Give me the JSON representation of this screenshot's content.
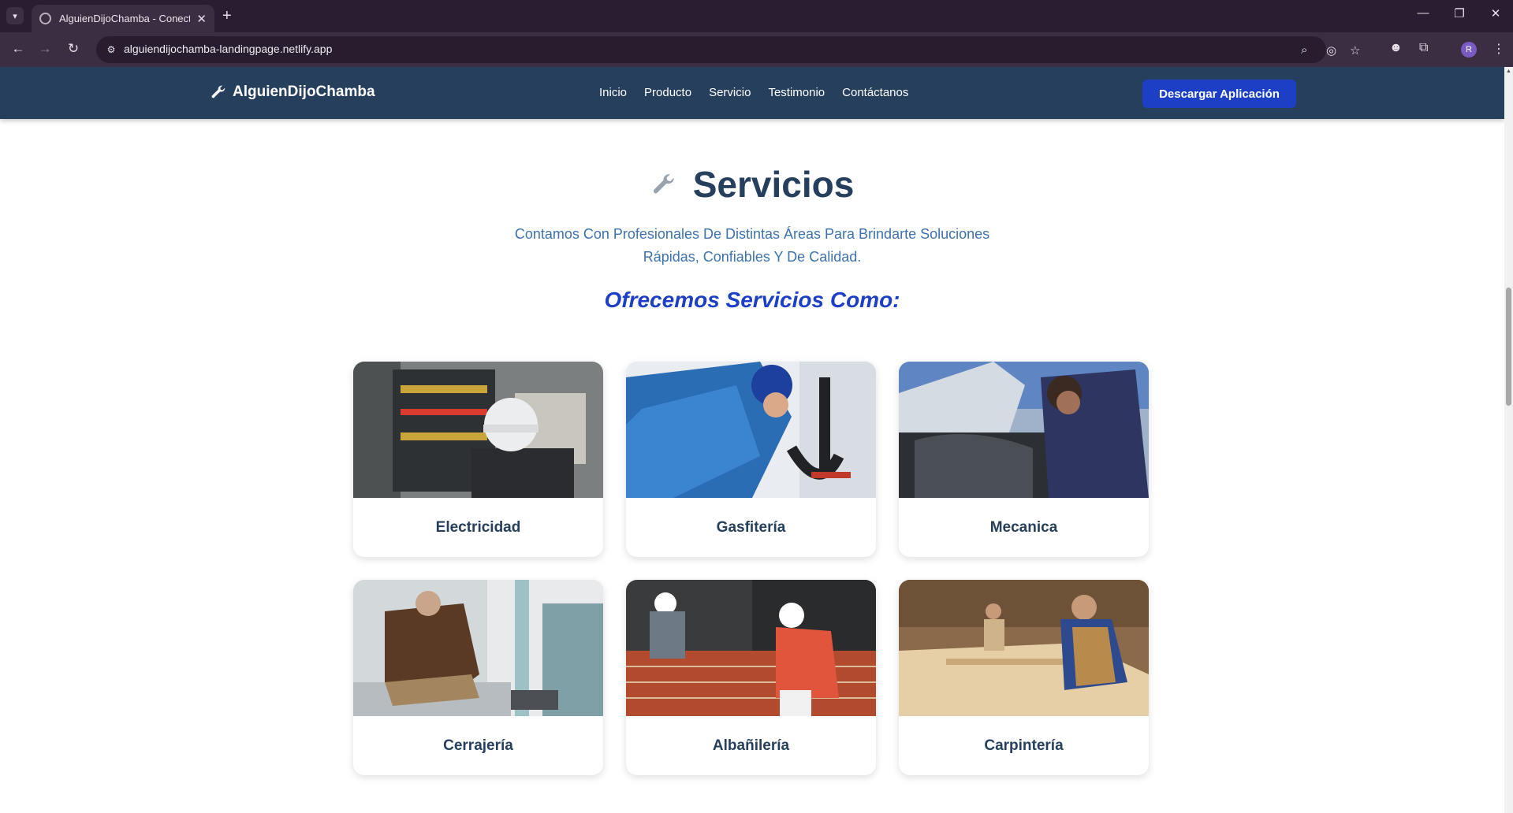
{
  "browser": {
    "tab_title": "AlguienDijoChamba - Conectan",
    "url": "alguiendijochamba-landingpage.netlify.app",
    "profile_initial": "R"
  },
  "navbar": {
    "brand": "AlguienDijoChamba",
    "menu": [
      "Inicio",
      "Producto",
      "Servicio",
      "Testimonio",
      "Contáctanos"
    ],
    "cta": "Descargar Aplicación",
    "colors": {
      "bar": "#263f5c",
      "cta": "#1d3fc6"
    }
  },
  "services": {
    "title": "Servicios",
    "subtitle_line1": "Contamos Con Profesionales De Distintas Áreas Para Brindarte Soluciones",
    "subtitle_line2": "Rápidas, Confiables Y De Calidad.",
    "offer_heading": "Ofrecemos Servicios Como:",
    "cards": [
      {
        "label": "Electricidad",
        "image": "electrician-panel-photo"
      },
      {
        "label": "Gasfitería",
        "image": "plumber-pipes-photo"
      },
      {
        "label": "Mecanica",
        "image": "mechanic-engine-photo"
      },
      {
        "label": "Cerrajería",
        "image": "locksmith-door-photo"
      },
      {
        "label": "Albañilería",
        "image": "bricklayer-wall-photo"
      },
      {
        "label": "Carpintería",
        "image": "carpenter-workshop-photo"
      }
    ]
  }
}
